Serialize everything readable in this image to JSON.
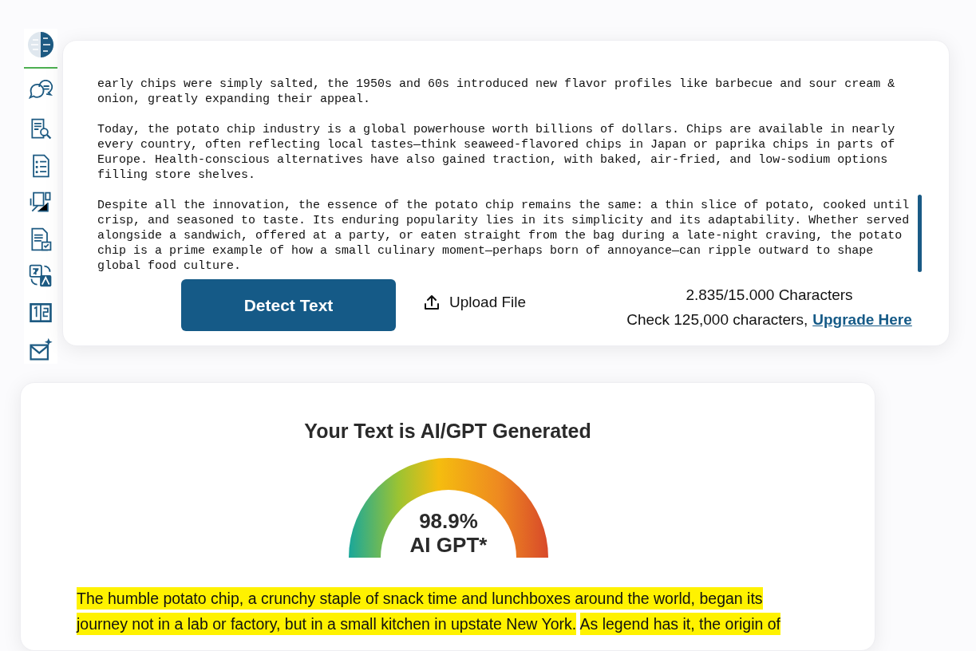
{
  "editor": {
    "paragraphs": [
      "early chips were simply salted, the 1950s and 60s introduced new flavor profiles like barbecue and sour cream & onion, greatly expanding their appeal.",
      "Today, the potato chip industry is a global powerhouse worth billions of dollars. Chips are available in nearly every country, often reflecting local tastes—think seaweed-flavored chips in Japan or paprika chips in parts of Europe. Health-conscious alternatives have also gained traction, with baked, air-fried, and low-sodium options filling store shelves.",
      "Despite all the innovation, the essence of the potato chip remains the same: a thin slice of potato, cooked until crisp, and seasoned to taste. Its enduring popularity lies in its simplicity and its adaptability. Whether served alongside a sandwich, offered at a party, or eaten straight from the bag during a late-night craving, the potato chip is a prime example of how a small culinary moment—perhaps born of annoyance—can ripple outward to shape global food culture."
    ]
  },
  "detect_button": "Detect Text",
  "upload_button": "Upload File",
  "char_count": "2.835/15.000 Characters",
  "upgrade_note": {
    "text": "Check 125,000 characters,",
    "link": "Upgrade Here"
  },
  "result": {
    "title": "Your Text is AI/GPT Generated",
    "score": "98.9%",
    "label": "AI GPT*",
    "sentences": [
      {
        "text": "The humble potato chip, a crunchy staple of snack time and lunchboxes around the world, began its journey not in a lab or factory, but in a small kitchen in upstate New York.",
        "highlighted": true
      },
      {
        "text": "As legend has it, the origin of",
        "highlighted": true
      }
    ]
  }
}
